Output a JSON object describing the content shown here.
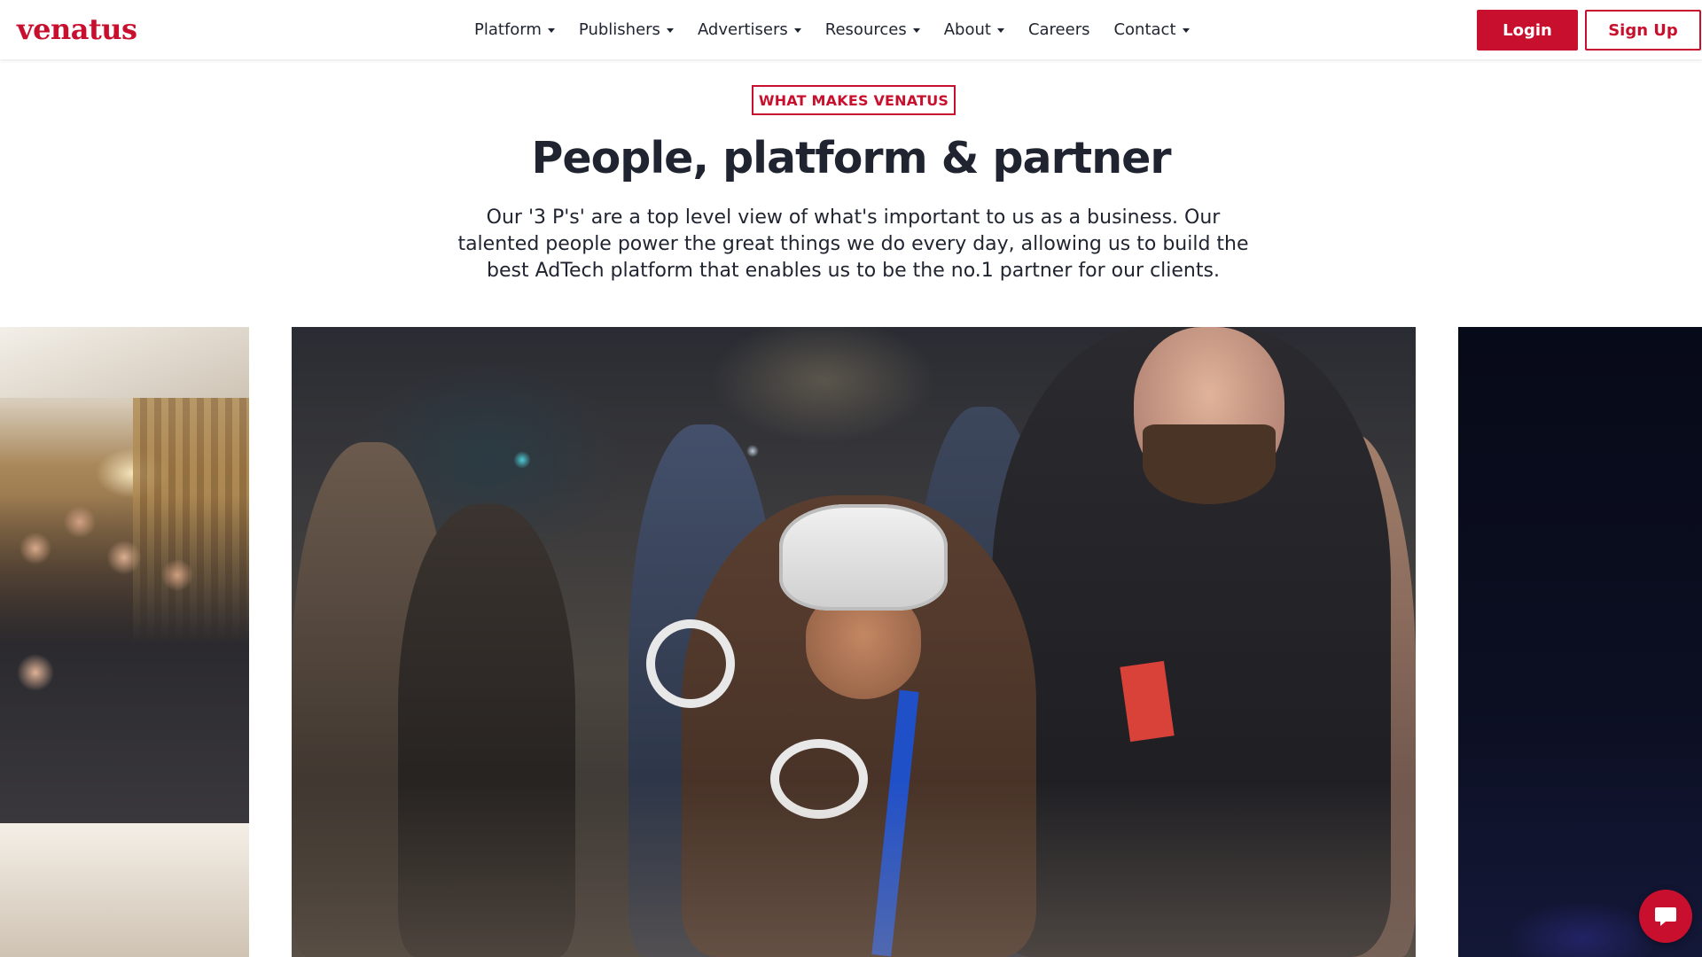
{
  "brand": {
    "logo_text": "venatus",
    "accent_color": "#c8102e"
  },
  "nav": {
    "items": [
      {
        "label": "Platform",
        "has_dropdown": true
      },
      {
        "label": "Publishers",
        "has_dropdown": true
      },
      {
        "label": "Advertisers",
        "has_dropdown": true
      },
      {
        "label": "Resources",
        "has_dropdown": true
      },
      {
        "label": "About",
        "has_dropdown": true
      },
      {
        "label": "Careers",
        "has_dropdown": false
      },
      {
        "label": "Contact",
        "has_dropdown": true
      }
    ],
    "login_label": "Login",
    "signup_label": "Sign Up"
  },
  "hero": {
    "tag": "WHAT MAKES VENATUS",
    "title": "People, platform & partner",
    "description": "Our '3 P's' are a top level view of what's important to us as a business. Our talented people power the great things we do every day, allowing us to build the best AdTech platform that enables us to be the no.1 partner for our clients."
  },
  "carousel": {
    "slides": [
      {
        "icon": "photo-group-celebration"
      },
      {
        "icon": "photo-vr-headset-event"
      },
      {
        "icon": "photo-dark-stage"
      }
    ]
  },
  "chat": {
    "icon": "chat-bubble-icon"
  }
}
